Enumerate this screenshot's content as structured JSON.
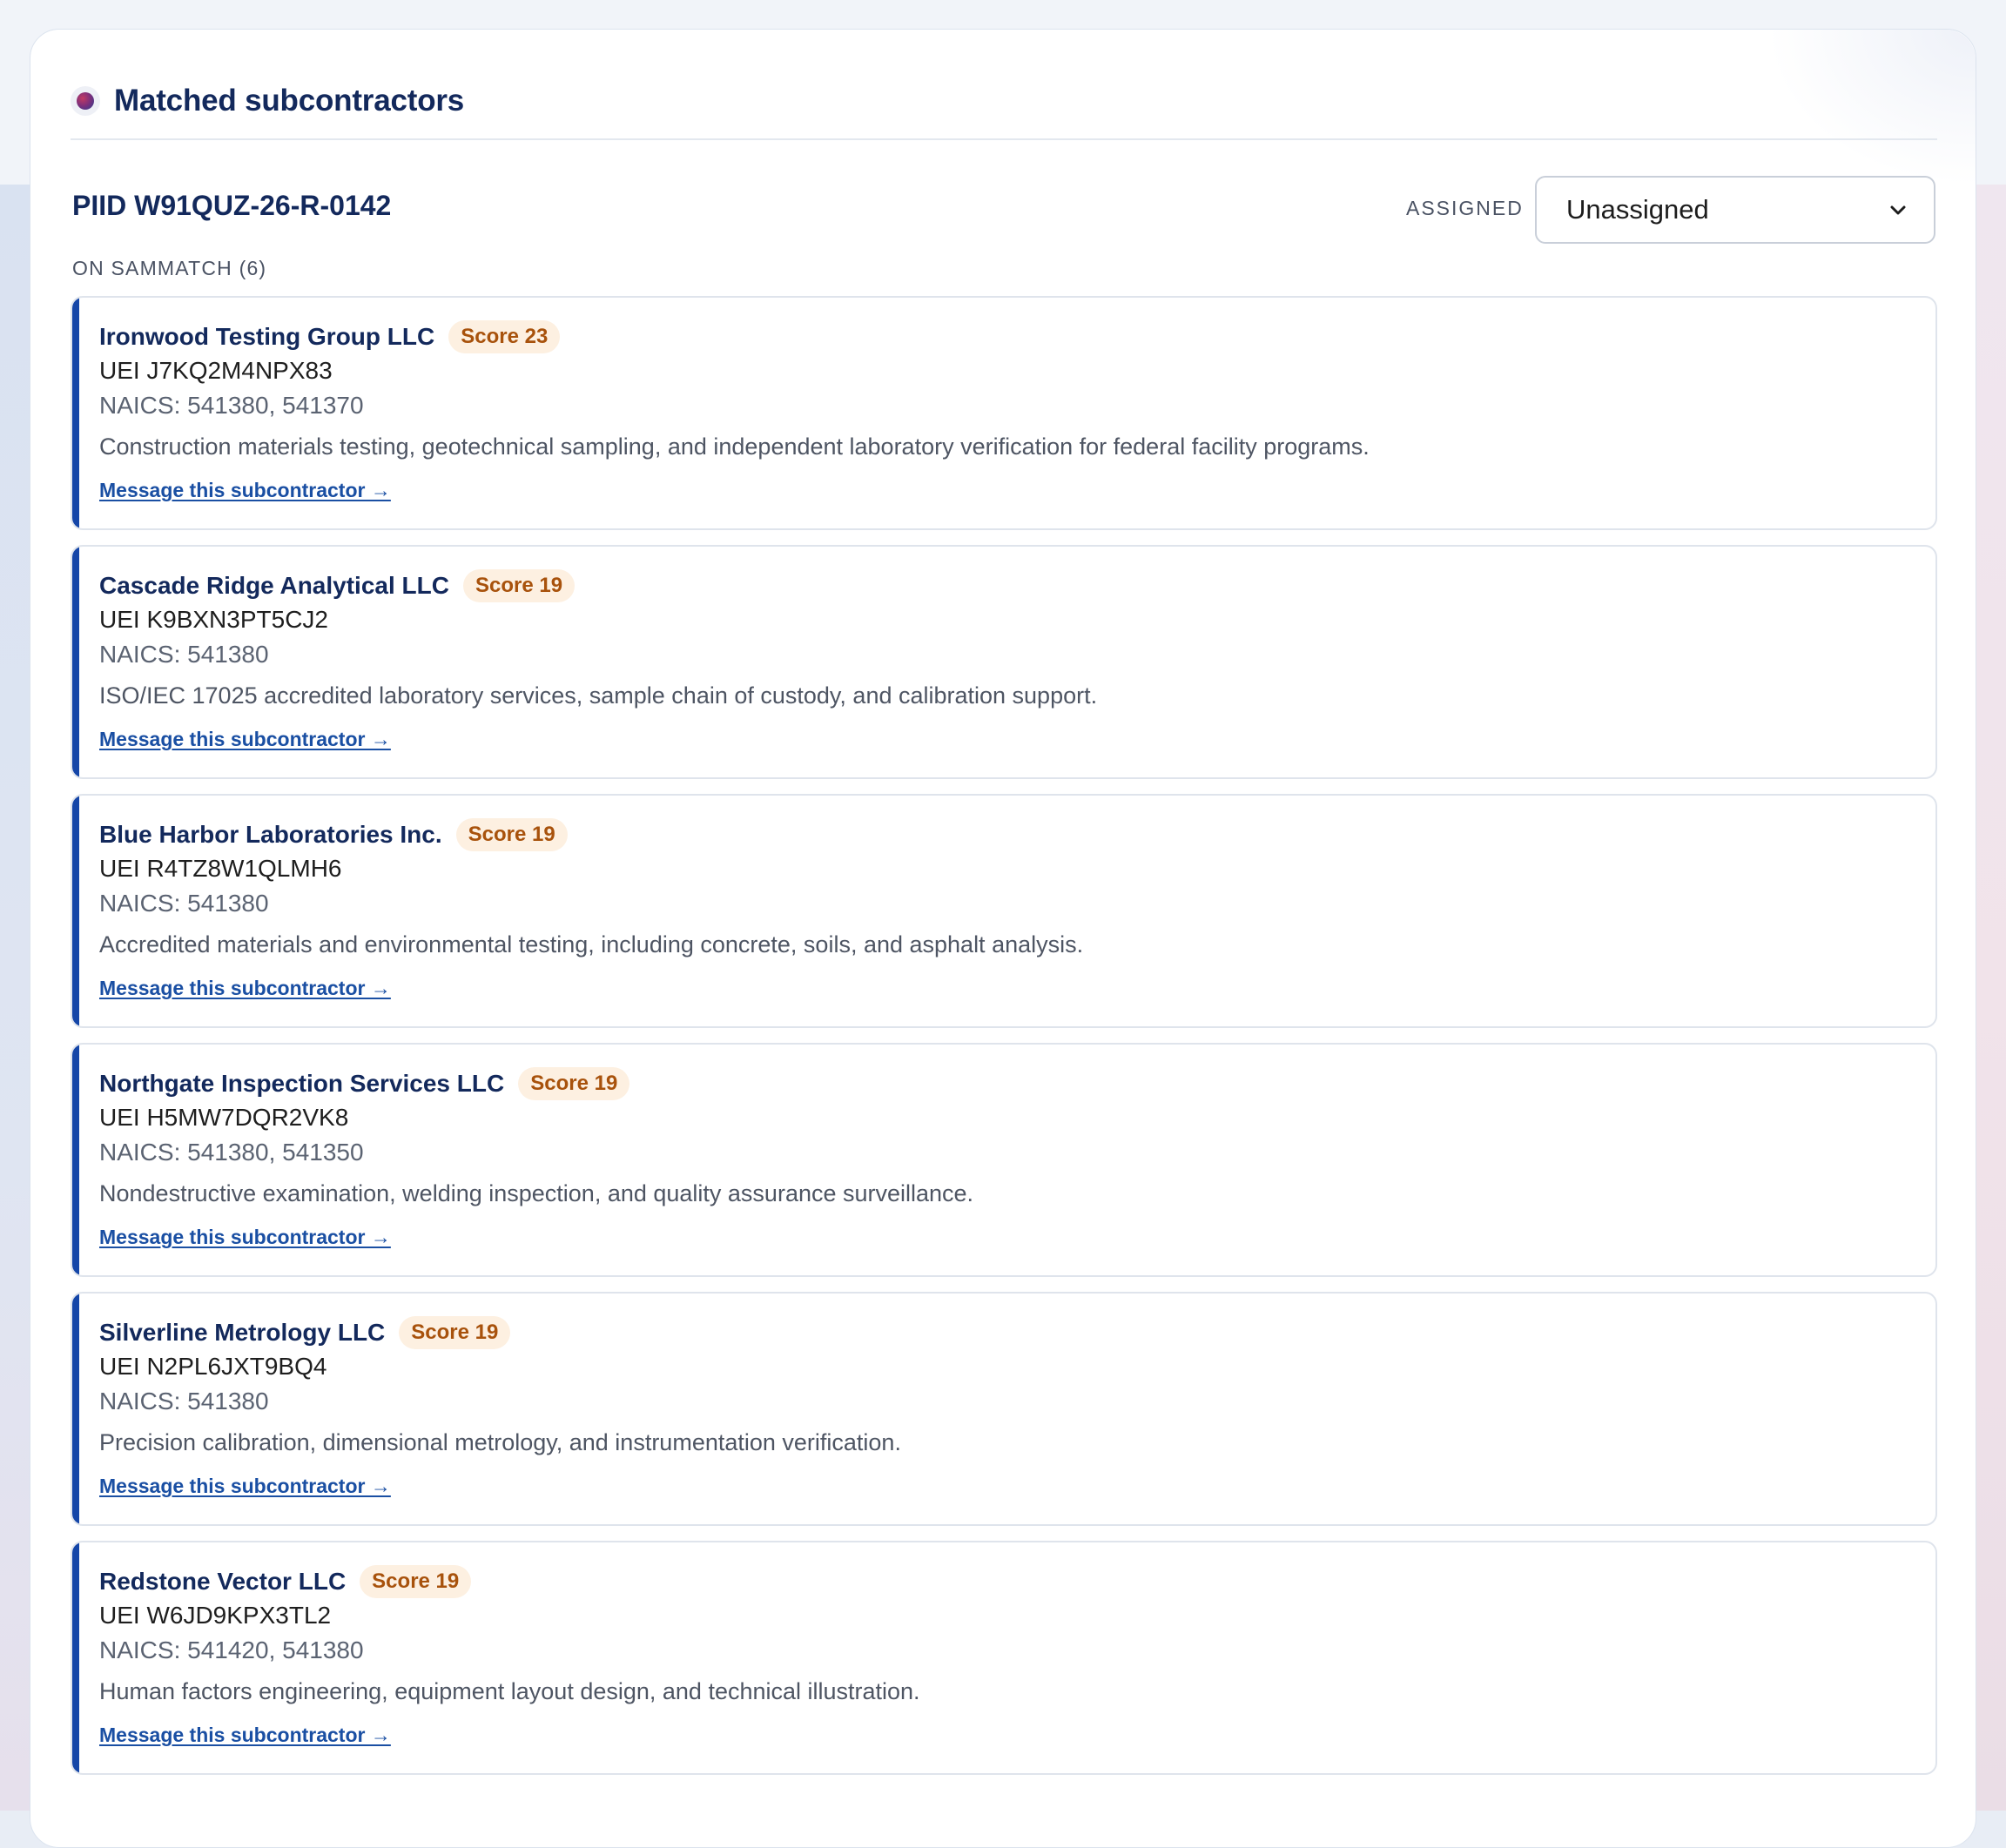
{
  "header": {
    "title": "Matched subcontractors"
  },
  "opportunity": {
    "piid": "PIID W91QUZ-26-R-0142",
    "assigned_label": "ASSIGNED",
    "assigned_value": "Unassigned",
    "count_label": "ON SAMMATCH (6)"
  },
  "subcontractors": [
    {
      "name": "Ironwood Testing Group LLC",
      "score": "Score 23",
      "uei": "UEI J7KQ2M4NPX83",
      "naics": "NAICS: 541380, 541370",
      "description": "Construction materials testing, geotechnical sampling, and independent laboratory verification for federal facility programs.",
      "link": "Message this subcontractor →"
    },
    {
      "name": "Cascade Ridge Analytical LLC",
      "score": "Score 19",
      "uei": "UEI K9BXN3PT5CJ2",
      "naics": "NAICS: 541380",
      "description": "ISO/IEC 17025 accredited laboratory services, sample chain of custody, and calibration support.",
      "link": "Message this subcontractor →"
    },
    {
      "name": "Blue Harbor Laboratories Inc.",
      "score": "Score 19",
      "uei": "UEI R4TZ8W1QLMH6",
      "naics": "NAICS: 541380",
      "description": "Accredited materials and environmental testing, including concrete, soils, and asphalt analysis.",
      "link": "Message this subcontractor →"
    },
    {
      "name": "Northgate Inspection Services LLC",
      "score": "Score 19",
      "uei": "UEI H5MW7DQR2VK8",
      "naics": "NAICS: 541380, 541350",
      "description": "Nondestructive examination, welding inspection, and quality assurance surveillance.",
      "link": "Message this subcontractor →"
    },
    {
      "name": "Silverline Metrology LLC",
      "score": "Score 19",
      "uei": "UEI N2PL6JXT9BQ4",
      "naics": "NAICS: 541380",
      "description": "Precision calibration, dimensional metrology, and instrumentation verification.",
      "link": "Message this subcontractor →"
    },
    {
      "name": "Redstone Vector LLC",
      "score": "Score 19",
      "uei": "UEI W6JD9KPX3TL2",
      "naics": "NAICS: 541420, 541380",
      "description": "Human factors engineering, equipment layout design, and technical illustration.",
      "link": "Message this subcontractor →"
    }
  ],
  "colors": {
    "accent": "#1546a8",
    "title": "#13295c",
    "score_text": "#a8520c",
    "score_bg": "#fdf0e1",
    "link": "#1a4fa3"
  },
  "icons": {
    "header": "status-dot-icon",
    "select": "chevron-down-icon"
  }
}
